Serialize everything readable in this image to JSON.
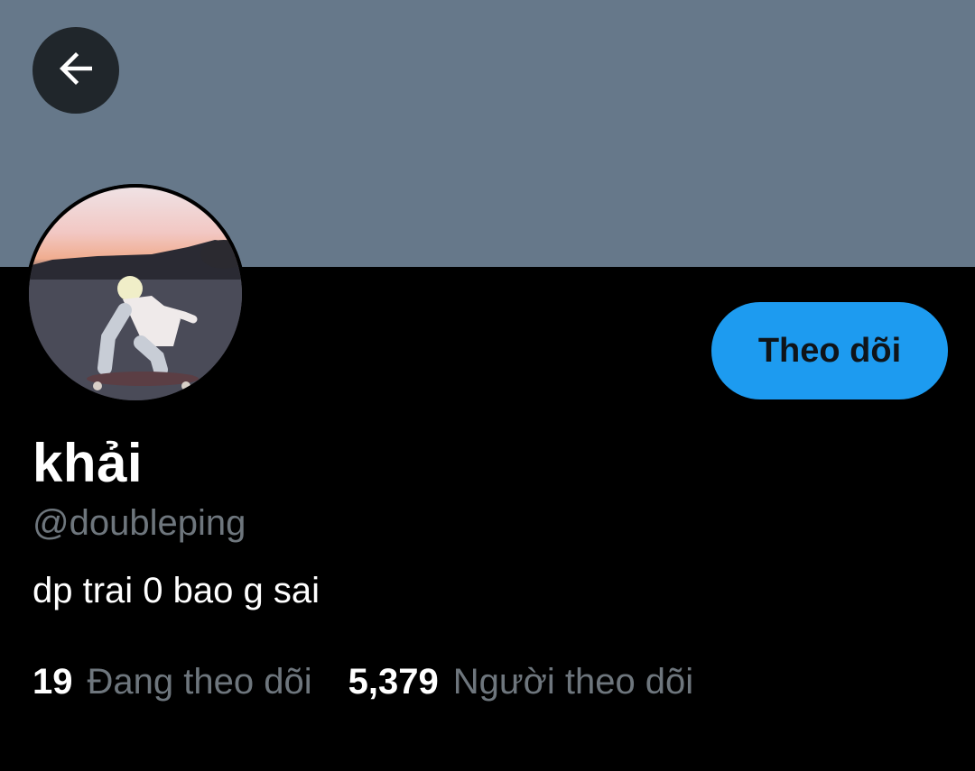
{
  "header": {
    "back_icon": "arrow-left-icon",
    "banner_color": "#66788a"
  },
  "profile": {
    "display_name": "khải",
    "handle": "@doubleping",
    "bio": "dp trai 0 bao g sai",
    "follow_label": "Theo dõi",
    "follow_color": "#1d9bf0"
  },
  "stats": {
    "following_count": "19",
    "following_label": "Đang theo dõi",
    "followers_count": "5,379",
    "followers_label": "Người theo dõi"
  }
}
